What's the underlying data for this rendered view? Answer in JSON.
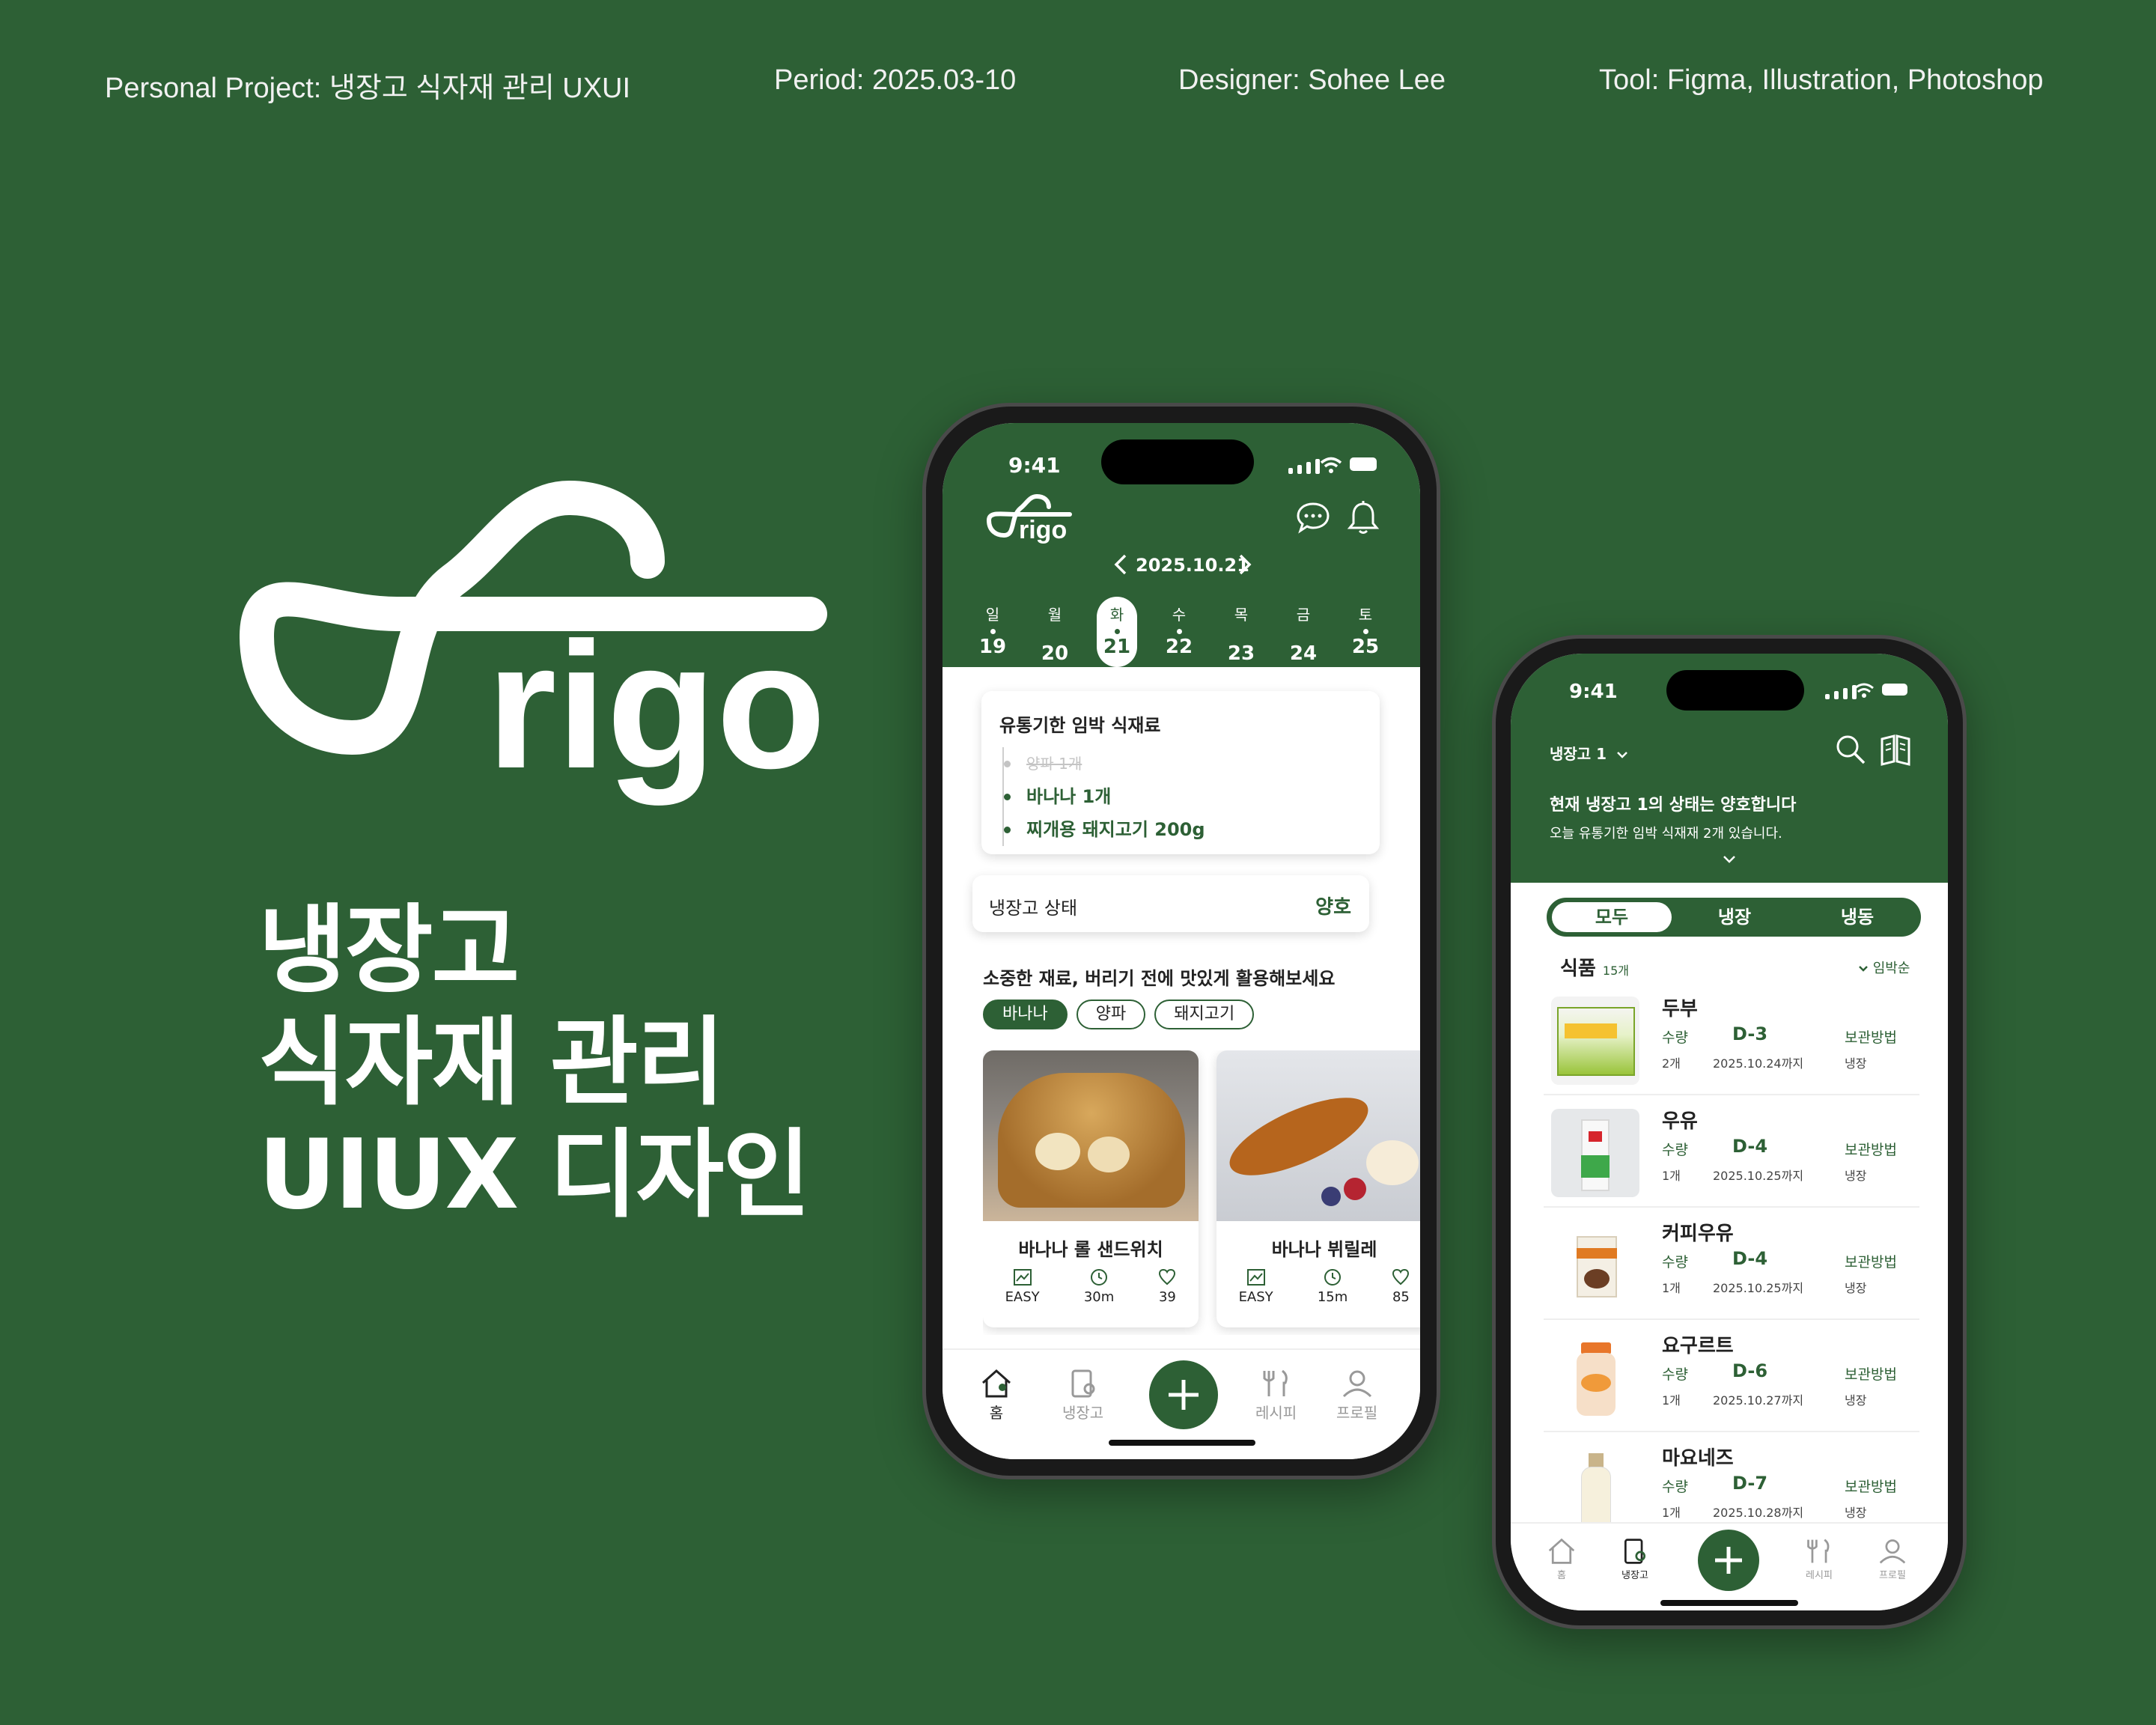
{
  "meta": {
    "project": "Personal Project: 냉장고 식자재 관리 UXUI",
    "period": "Period: 2025.03-10",
    "designer": "Designer: Sohee Lee",
    "tool": "Tool: Figma, Illustration, Photoshop"
  },
  "brand": {
    "wordmark": "rigo",
    "accent": "#2d6035"
  },
  "headline": [
    "냉장고",
    "식자재 관리",
    "UIUX 디자인"
  ],
  "phone_home": {
    "time": "9:41",
    "logo": "rigo",
    "header_icons": [
      "chat-icon",
      "bell-icon"
    ],
    "date": "2025.10.21",
    "week": [
      {
        "label": "일",
        "day": "19"
      },
      {
        "label": "월",
        "day": "20"
      },
      {
        "label": "화",
        "day": "21",
        "selected": true
      },
      {
        "label": "수",
        "day": "22"
      },
      {
        "label": "목",
        "day": "23"
      },
      {
        "label": "금",
        "day": "24"
      },
      {
        "label": "토",
        "day": "25"
      }
    ],
    "expiring": {
      "title": "유통기한 임박 식재료",
      "items": [
        {
          "text": "양파 1개",
          "done": true
        },
        {
          "text": "바나나 1개",
          "done": false
        },
        {
          "text": "찌개용 돼지고기 200g",
          "done": false
        }
      ]
    },
    "fridge_status": {
      "label": "냉장고 상태",
      "value": "양호"
    },
    "recipe_section": {
      "title": "소중한 재료, 버리기 전에 맛있게 활용해보세요",
      "chips": [
        "바나나",
        "양파",
        "돼지고기"
      ],
      "cards": [
        {
          "title": "바나나 롤 샌드위치",
          "level": "EASY",
          "time": "30m",
          "likes": "39"
        },
        {
          "title": "바나나 뷔릴레",
          "level": "EASY",
          "time": "15m",
          "likes": "85"
        }
      ]
    },
    "tabs": [
      "홈",
      "냉장고",
      "레시피",
      "프로필"
    ]
  },
  "phone_fridge": {
    "time": "9:41",
    "fridge_select": "냉장고 1",
    "status_title": "현재 냉장고 1의 상태는 양호합니다",
    "status_sub": "오늘 유통기한 임박 식재재 2개 있습니다.",
    "segments": [
      "모두",
      "냉장",
      "냉동"
    ],
    "list_title": "식품",
    "list_count": "15개",
    "sort": "임박순",
    "foods": [
      {
        "name": "두부",
        "qty_label": "수량",
        "qty": "2개",
        "dday": "D-3",
        "date": "2025.10.24까지",
        "store_label": "보관방법",
        "store": "냉장"
      },
      {
        "name": "우유",
        "qty_label": "수량",
        "qty": "1개",
        "dday": "D-4",
        "date": "2025.10.25까지",
        "store_label": "보관방법",
        "store": "냉장"
      },
      {
        "name": "커피우유",
        "qty_label": "수량",
        "qty": "1개",
        "dday": "D-4",
        "date": "2025.10.25까지",
        "store_label": "보관방법",
        "store": "냉장"
      },
      {
        "name": "요구르트",
        "qty_label": "수량",
        "qty": "1개",
        "dday": "D-6",
        "date": "2025.10.27까지",
        "store_label": "보관방법",
        "store": "냉장"
      },
      {
        "name": "마요네즈",
        "qty_label": "수량",
        "qty": "1개",
        "dday": "D-7",
        "date": "2025.10.28까지",
        "store_label": "보관방법",
        "store": "냉장"
      }
    ],
    "tabs": [
      "홈",
      "냉장고",
      "레시피",
      "프로필"
    ]
  }
}
